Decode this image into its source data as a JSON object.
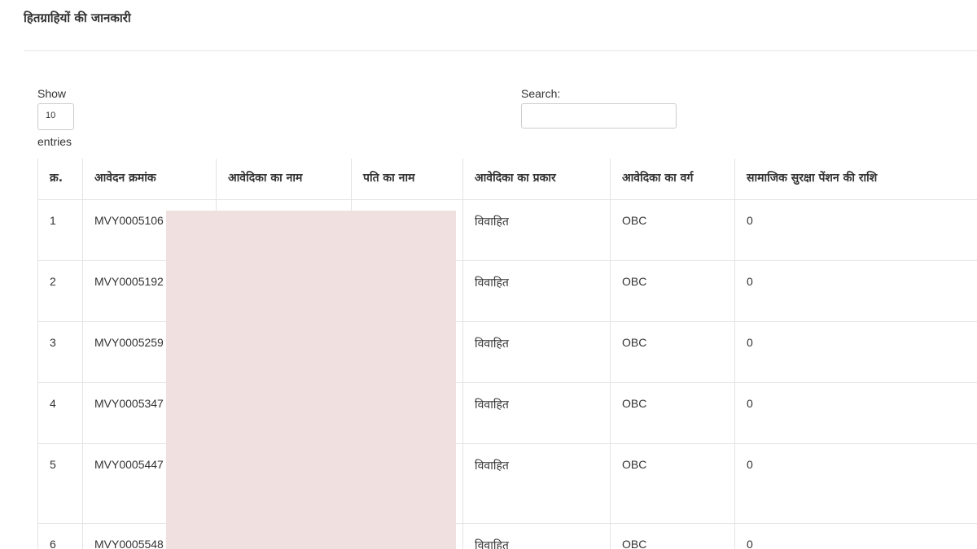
{
  "page": {
    "title": "हितग्राहियों की जानकारी"
  },
  "controls": {
    "show_label": "Show",
    "entries_value": "10",
    "entries_label": "entries",
    "search_label": "Search:",
    "search_value": ""
  },
  "table": {
    "headers": [
      "क्र.",
      "आवेदन क्रमांक",
      "आवेदिका का नाम",
      "पति का नाम",
      "आवेदिका का प्रकार",
      "आवेदिका का वर्ग",
      "सामाजिक सुरक्षा पेंशन की राशि"
    ],
    "rows": [
      {
        "sno": "1",
        "app_no": "MVY0005106",
        "name": "",
        "husband": "",
        "type": "विवाहित",
        "category": "OBC",
        "pension": "0"
      },
      {
        "sno": "2",
        "app_no": "MVY0005192",
        "name": "",
        "husband": "",
        "type": "विवाहित",
        "category": "OBC",
        "pension": "0"
      },
      {
        "sno": "3",
        "app_no": "MVY0005259",
        "name": "",
        "husband": "",
        "type": "विवाहित",
        "category": "OBC",
        "pension": "0"
      },
      {
        "sno": "4",
        "app_no": "MVY0005347",
        "name": "",
        "husband": "",
        "type": "विवाहित",
        "category": "OBC",
        "pension": "0"
      },
      {
        "sno": "5",
        "app_no": "MVY0005447",
        "name": "",
        "husband": "",
        "type": "विवाहित",
        "category": "OBC",
        "pension": "0"
      },
      {
        "sno": "6",
        "app_no": "MVY0005548",
        "name": "",
        "husband": "",
        "type": "विवाहित",
        "category": "OBC",
        "pension": "0"
      }
    ]
  },
  "colors": {
    "redaction": "#f0e0e0",
    "border": "#e3e3e3"
  }
}
